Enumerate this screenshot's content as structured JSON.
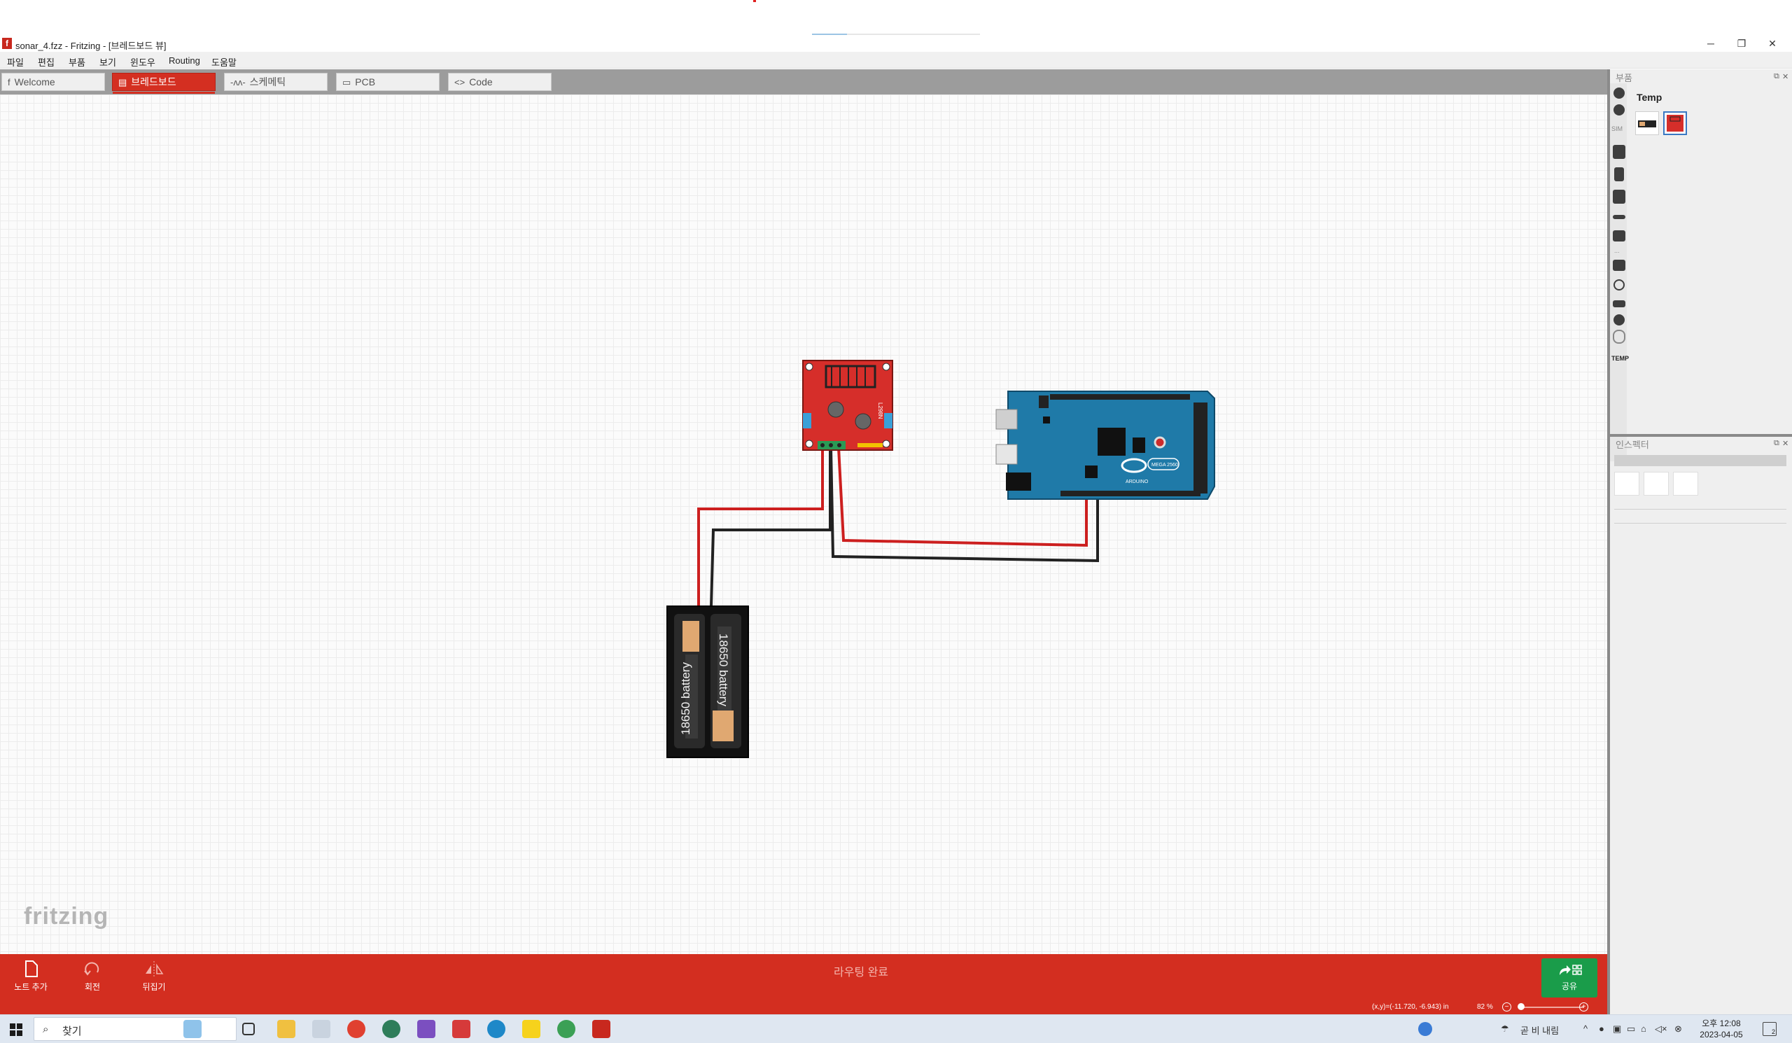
{
  "window": {
    "title": "sonar_4.fzz - Fritzing - [브레드보드 뷰]",
    "app_icon": "f",
    "controls": {
      "minimize": "─",
      "restore": "❐",
      "close": "✕"
    }
  },
  "menu": [
    "파일",
    "편집",
    "부품",
    "보기",
    "윈도우",
    "Routing",
    "도움말"
  ],
  "tabs": [
    {
      "label": "Welcome",
      "icon": "f",
      "active": false
    },
    {
      "label": "브레드보드",
      "icon": "▤",
      "active": true
    },
    {
      "label": "스케메틱",
      "icon": "-ʌʌ-",
      "active": false
    },
    {
      "label": "PCB",
      "icon": "▭",
      "active": false
    },
    {
      "label": "Code",
      "icon": "<>",
      "active": false
    }
  ],
  "canvas": {
    "watermark": "fritzing",
    "parts": {
      "motor_driver": {
        "label": "L298N",
        "color": "#d62e2a"
      },
      "arduino": {
        "label": "MEGA 2560",
        "brand": "ARDUINO",
        "color": "#1f7aa8"
      },
      "battery_left": "18650 battery",
      "battery_right": "18650 battery"
    },
    "wire_colors": {
      "power": "#cc1f1f",
      "ground": "#222222"
    }
  },
  "toolbar": {
    "add_note": "노트 추가",
    "rotate": "회전",
    "flip": "뒤집기",
    "routing_status": "라우팅 완료",
    "share": "공유"
  },
  "statusbar": {
    "coords": "(x,y)=(-11.720, -6.943) in",
    "zoom": "82 %"
  },
  "parts_panel": {
    "title": "부품",
    "bin_label_sim": "SIM",
    "bin_label_temp": "TEMP",
    "bin_title": "Temp",
    "ellipsis": "..."
  },
  "inspector": {
    "title": "인스펙터"
  },
  "taskbar": {
    "search_placeholder": "찾기",
    "weather": "곧 비 내림",
    "time": "오후 12:08",
    "date": "2023-04-05",
    "notifications": "2"
  }
}
